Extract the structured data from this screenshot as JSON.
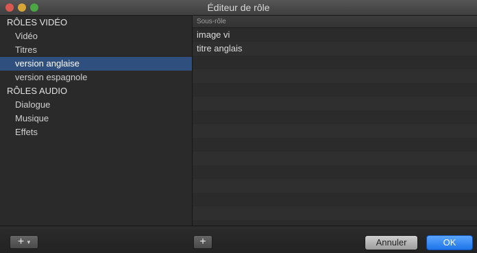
{
  "window": {
    "title": "Éditeur de rôle"
  },
  "sidebar": {
    "video_header": "RÔLES VIDÉO",
    "video_items": [
      "Vidéo",
      "Titres",
      "version anglaise",
      "version espagnole"
    ],
    "audio_header": "RÔLES AUDIO",
    "audio_items": [
      "Dialogue",
      "Musique",
      "Effets"
    ],
    "selected": "version anglaise"
  },
  "subroles": {
    "column_header": "Sous-rôle",
    "rows": [
      "image vi",
      "titre anglais"
    ]
  },
  "footer": {
    "add_left_label": "+",
    "add_left_caret": "▾",
    "add_right_label": "+",
    "cancel_label": "Annuler",
    "ok_label": "OK"
  }
}
